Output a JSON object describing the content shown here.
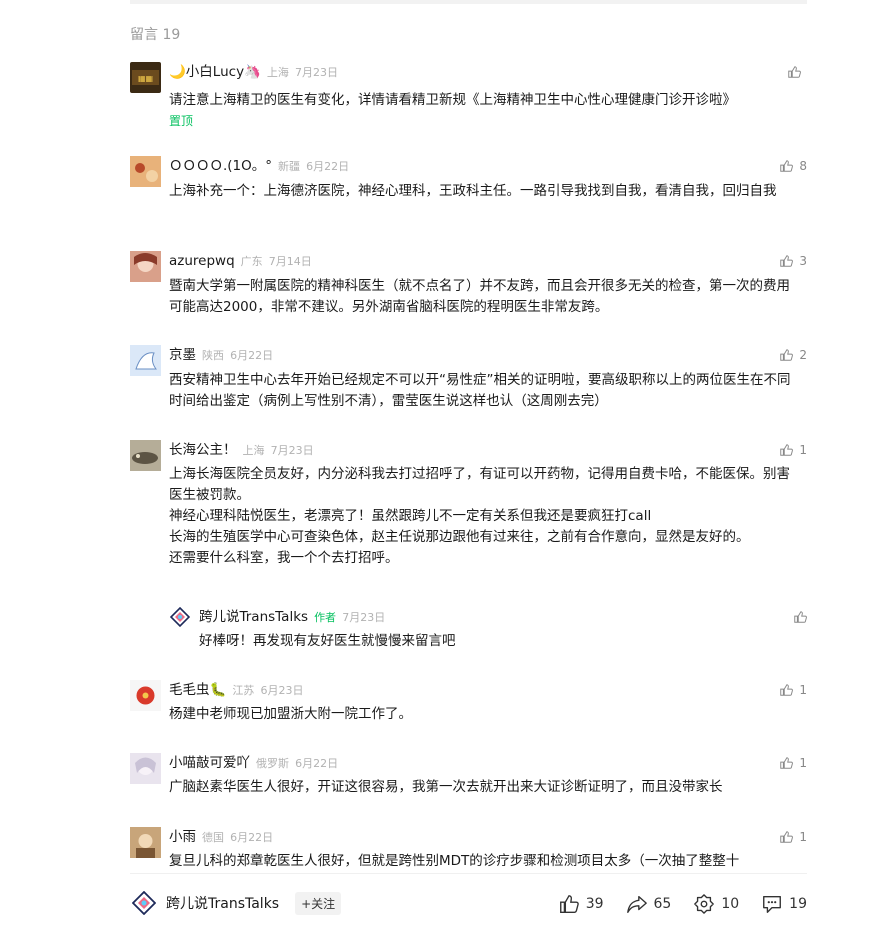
{
  "section": {
    "title": "留言 19"
  },
  "comments": [
    {
      "nick": "🌙小白Lucy🦄",
      "location": "上海",
      "date": "7月23日",
      "likes": "",
      "text": "请注意上海精卫的医生有变化，详情请看精卫新规《上海精神卫生中心性心理健康门诊开诊啦》",
      "pinned": "置顶"
    },
    {
      "nick": "ＯＯＯＯ.(1О。°",
      "location": "新疆",
      "date": "6月22日",
      "likes": "8",
      "text": "上海补充一个：上海德济医院，神经心理科，王政科主任。一路引导我找到自我，看清自我，回归自我"
    },
    {
      "nick": "azurepwq",
      "location": "广东",
      "date": "7月14日",
      "likes": "3",
      "text": "暨南大学第一附属医院的精神科医生（就不点名了）并不友跨，而且会开很多无关的检查，第一次的费用可能高达2000，非常不建议。另外湖南省脑科医院的程明医生非常友跨。"
    },
    {
      "nick": "京墨",
      "location": "陕西",
      "date": "6月22日",
      "likes": "2",
      "text": "西安精神卫生中心去年开始已经规定不可以开“易性症”相关的证明啦，要高级职称以上的两位医生在不同时间给出鉴定（病例上写性别不清），雷莹医生说这样也认（这周刚去完）"
    },
    {
      "nick": "长海公主！",
      "location": "上海",
      "date": "7月23日",
      "likes": "1",
      "text_lines": [
        "上海长海医院全员友好，内分泌科我去打过招呼了，有证可以开药物，记得用自费卡哈，不能医保。别害医生被罚款。",
        "神经心理科陆悦医生，老漂亮了！虽然跟跨儿不一定有关系但我还是要疯狂打call",
        "长海的生殖医学中心可查染色体，赵主任说那边跟他有过来往，之前有合作意向，显然是友好的。",
        "还需要什么科室，我一个个去打招呼。"
      ]
    },
    {
      "nick": "毛毛虫🐛",
      "location": "江苏",
      "date": "6月23日",
      "likes": "1",
      "text": "杨建中老师现已加盟浙大附一院工作了。"
    },
    {
      "nick": "小喵敲可爱吖",
      "location": "俄罗斯",
      "date": "6月22日",
      "likes": "1",
      "text": "广脑赵素华医生人很好，开证这很容易，我第一次去就开出来大证诊断证明了，而且没带家长"
    },
    {
      "nick": "小雨",
      "location": "德国",
      "date": "6月22日",
      "likes": "1",
      "text": "复旦儿科的郑章乾医生人很好，但就是跨性别MDT的诊疗步骤和检测项目太多（一次抽了整整十"
    }
  ],
  "reply": {
    "nick": "跨儿说TransTalks",
    "tag": "作者",
    "date": "7月23日",
    "text": "好棒呀！再发现有友好医生就慢慢来留言吧"
  },
  "bottom": {
    "brand": "跨儿说TransTalks",
    "follow": "+关注",
    "like_count": "39",
    "share_count": "65",
    "wow_count": "10",
    "comment_count": "19"
  },
  "colors": {
    "accent": "#07c160",
    "meta": "#b2b2b2"
  },
  "icons": [
    "thumbs-up-icon",
    "share-icon",
    "wow-icon",
    "comment-icon",
    "brand-logo-icon"
  ]
}
